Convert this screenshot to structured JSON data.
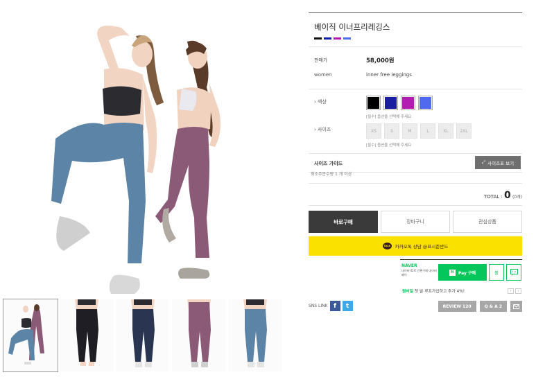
{
  "product": {
    "title": "베이직 이너프리레깅스",
    "swatch_colors": [
      "#111111",
      "#0d1ea8",
      "#b215b0",
      "#4a6cf0"
    ],
    "price_label": "판매가",
    "price": "58,000원",
    "gender_label": "women",
    "subtitle": "inner free leggings"
  },
  "options": {
    "color_label": "› 색상",
    "colors": [
      "#000000",
      "#1a1fa0",
      "#b31cb0",
      "#4f69ef"
    ],
    "color_required": "[필수] 옵션을 선택해 주세요",
    "size_label": "› 사이즈",
    "sizes": [
      "XS",
      "S",
      "M",
      "L",
      "XL",
      "2XL"
    ],
    "size_required": "[필수] 옵션을 선택해 주세요"
  },
  "size_guide": {
    "label": "사이즈 가이드",
    "button": "사이즈표 보기",
    "icon": "expand-icon"
  },
  "min_order": "최소주문수량 1 개 이상",
  "total": {
    "label": "TOTAL : ",
    "value": "0",
    "count": "(0개)"
  },
  "buttons": {
    "buy": "바로구매",
    "cart": "장바구니",
    "wish": "관심상품"
  },
  "kakao": {
    "icon_text": "TALK",
    "label": "카카오톡 상담 @표시준반드"
  },
  "naver": {
    "logo": "NAVER",
    "sub": "네이버 ID로 간편구매 네이버페이",
    "pay_icon": "N",
    "pay_label": "Pay 구매",
    "zzim": "찜",
    "talk_icon": "talk-icon",
    "promo_highlight": "원버일",
    "promo_text": "첫 발 루프가입하고 추가 4%!",
    "prev": "‹",
    "next": "›"
  },
  "sns": {
    "label": "SNS LINK",
    "fb": "f",
    "tw": "t"
  },
  "mini_buttons": {
    "review": "REVIEW 120",
    "qa": "Q & A 2",
    "mail_icon": "mail-icon"
  },
  "colors": {
    "dark_button": "#3a3a3a",
    "kakao_yellow": "#fae100",
    "naver_green": "#03c75a",
    "leggings_blue": "#5b84a6",
    "leggings_mauve": "#8a5a77"
  }
}
